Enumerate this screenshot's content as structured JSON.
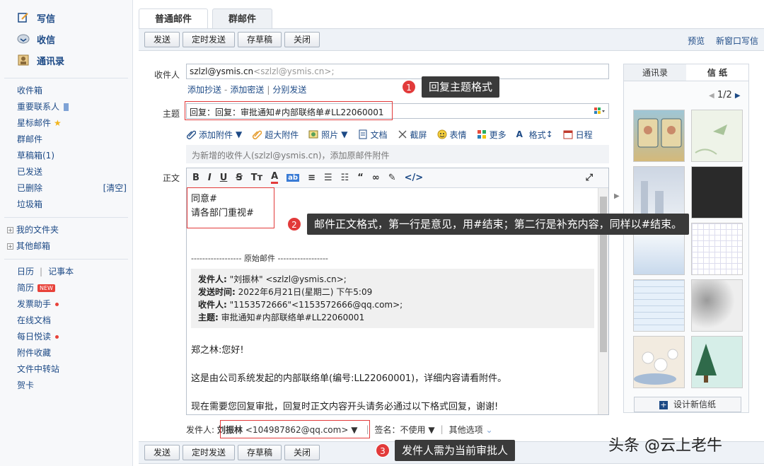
{
  "sidebar": {
    "main": [
      {
        "label": "写信",
        "icon": "pencil-icon"
      },
      {
        "label": "收信",
        "icon": "inbox-icon"
      },
      {
        "label": "通讯录",
        "icon": "contacts-icon"
      }
    ],
    "folders": [
      "收件箱",
      "重要联系人",
      "星标邮件",
      "群邮件",
      "草稿箱(1)",
      "已发送",
      "已删除",
      "垃圾箱"
    ],
    "clear_label": "[清空]",
    "tree": [
      "我的文件夹",
      "其他邮箱"
    ],
    "calendar": "日历",
    "notes": "记事本",
    "tools": [
      "简历",
      "发票助手",
      "在线文档",
      "每日悦读",
      "附件收藏",
      "文件中转站",
      "贺卡"
    ],
    "new_badge": "NEW"
  },
  "tabs": [
    "普通邮件",
    "群邮件"
  ],
  "toolbar": {
    "send": "发送",
    "scheduled": "定时发送",
    "draft": "存草稿",
    "close": "关闭",
    "preview": "预览",
    "new_window": "新窗口写信"
  },
  "compose": {
    "to_label": "收件人",
    "to_value": "szlzl@ysmis.cn",
    "to_value2": "<szlzl@ysmis.cn>;",
    "cc_links": [
      "添加抄送",
      "添加密送",
      "分别发送"
    ],
    "subject_label": "主题",
    "subject_value": "回复：回复：审批通知#内部联络单#LL22060001",
    "attach_items": [
      "添加附件",
      "超大附件",
      "照片",
      "文档",
      "截屏",
      "表情",
      "更多",
      "格式",
      "日程"
    ],
    "hint": "为新增的收件人(szlzl@ysmis.cn)，添加原邮件附件",
    "body_label": "正文",
    "editor_tools": [
      "B",
      "I",
      "U",
      "Ꞩ",
      "Tт",
      "A",
      "ab",
      "≡",
      "☰",
      "☷",
      "“",
      "∞",
      "✎",
      "</>"
    ],
    "body_line1": "同意#",
    "body_line2": "请各部门重视#",
    "quote_header": "------------------ 原始邮件 ------------------",
    "quote_from_label": "发件人:",
    "quote_from": "\"刘振林\" <szlzl@ysmis.cn>;",
    "quote_time_label": "发送时间:",
    "quote_time": "2022年6月21日(星期二) 下午5:09",
    "quote_to_label": "收件人:",
    "quote_to": "\"1153572666\"<1153572666@qq.com>;",
    "quote_subj_label": "主题:",
    "quote_subj": "审批通知#内部联络单#LL22060001",
    "greeting": "郑之林:您好!",
    "para1": "这是由公司系统发起的内部联络单(编号:LL22060001)，详细内容请看附件。",
    "para2": "现在需要您回复审批，回复时正文内容开头请务必通过以下格式回复，谢谢!",
    "sender_label": "发件人:",
    "sender_name": "刘振林",
    "sender_email": "<104987862@qq.com>",
    "sign_label": "签名：",
    "sign_value": "不使用",
    "other_options": "其他选项"
  },
  "right_panel": {
    "tabs": [
      "通讯录",
      "信 纸"
    ],
    "pager": "1/2",
    "design_button": "设计新信纸"
  },
  "callouts": [
    {
      "num": "1",
      "text": "回复主题格式"
    },
    {
      "num": "2",
      "text": "邮件正文格式，第一行是意见，用#结束；第二行是补充内容，同样以#结束。"
    },
    {
      "num": "3",
      "text": "发件人需为当前审批人"
    }
  ],
  "watermark": "头条 @云上老牛",
  "colors": {
    "link": "#1d4a86",
    "highlight": "#e23a3a",
    "callout_bg": "#3a3a3a"
  }
}
